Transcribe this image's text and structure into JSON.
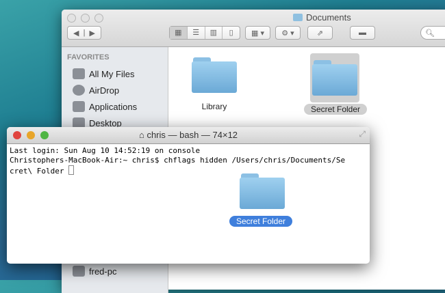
{
  "finder": {
    "title": "Documents",
    "sidebar_heading": "FAVORITES",
    "sidebar_items": [
      "All My Files",
      "AirDrop",
      "Applications",
      "Desktop"
    ],
    "shared_item": "fred-pc",
    "files": [
      {
        "name": "Library",
        "selected": false
      },
      {
        "name": "Secret Folder",
        "selected": true
      }
    ]
  },
  "terminal": {
    "title": "chris — bash — 74×12",
    "lines": [
      "Last login: Sun Aug 10 14:52:19 on console",
      "Christophers-MacBook-Air:~ chris$ chflags hidden /Users/chris/Documents/Se",
      "cret\\ Folder "
    ]
  },
  "floating_folder": {
    "name": "Secret Folder"
  }
}
